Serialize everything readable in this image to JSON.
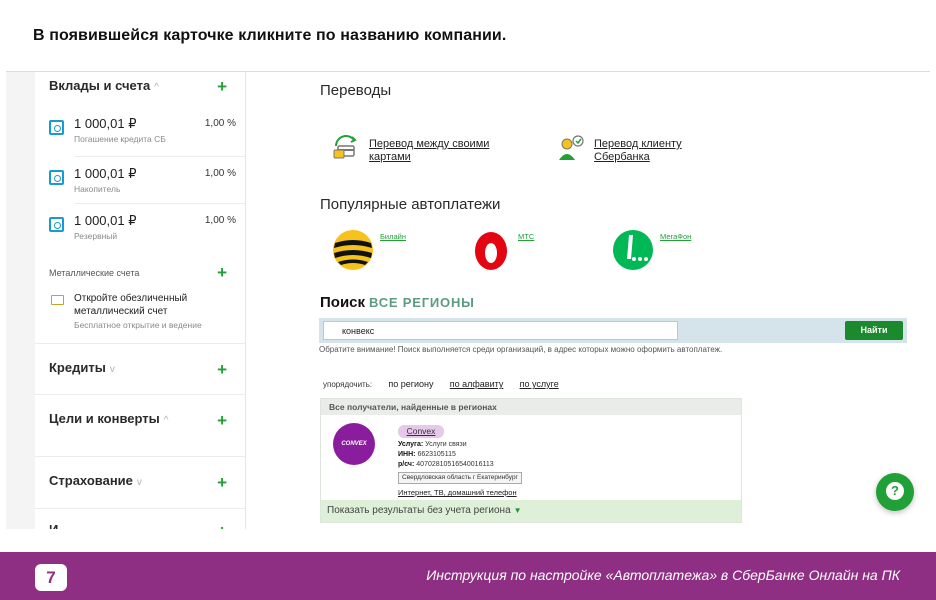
{
  "instruction": "В появившейся карточке кликните по названию компании.",
  "sidebar": {
    "deposits": {
      "title": "Вклады и счета",
      "chevron": "^",
      "plus": "+"
    },
    "accounts": [
      {
        "amount": "1 000,01 ₽",
        "name": "Погашение кредита СБ",
        "rate": "1,00 %"
      },
      {
        "amount": "1 000,01 ₽",
        "name": "Накопитель",
        "rate": "1,00 %"
      },
      {
        "amount": "1 000,01 ₽",
        "name": "Резервный",
        "rate": "1,00 %"
      }
    ],
    "metal": {
      "title": "Металлические счета",
      "plus": "+",
      "item_title": "Откройте обезличенный металлический счет",
      "item_sub": "Бесплатное открытие и ведение"
    },
    "credits": {
      "title": "Кредиты",
      "chevron": "v",
      "plus": "+"
    },
    "goals": {
      "title": "Цели и конверты",
      "chevron": "^",
      "plus": "+"
    },
    "insurance": {
      "title": "Страхование",
      "chevron": "v",
      "plus": "+"
    },
    "more": {
      "title": "И",
      "plus": "+"
    }
  },
  "main": {
    "transfers_title": "Переводы",
    "transfer_own": "Перевод между своими картами",
    "transfer_client": "Перевод клиенту Сбербанка",
    "autopay_title": "Популярные автоплатежи",
    "autopay": [
      {
        "name": "Билайн",
        "color": "#f6c21b"
      },
      {
        "name": "МТС",
        "color": "#e30611"
      },
      {
        "name": "МегаФон",
        "color": "#00b956"
      }
    ],
    "search": {
      "title": "Поиск",
      "region_link": "ВСЕ РЕГИОНЫ",
      "value": "конвекс",
      "button": "Найти",
      "note": "Обратите внимание! Поиск выполняется среди организаций, в адрес которых можно оформить автоплатеж."
    },
    "sort": {
      "label": "упорядочить:",
      "by_region": "по региону",
      "by_alpha": "по алфавиту",
      "by_service": "по услуге"
    },
    "results": {
      "header": "Все получатели, найденные в регионах",
      "company": {
        "logo_text": "CONVEX",
        "name": "Convex",
        "service_label": "Услуга:",
        "service": "Услуги связи",
        "inn_label": "ИНН:",
        "inn": "6623105115",
        "account_label": "р/сч:",
        "account": "40702810516540016113",
        "region": "Свердловская область г Екатеринбург",
        "services": "Интернет, ТВ, домашний телефон"
      },
      "show_all": "Показать результаты без учета региона"
    },
    "help": "?"
  },
  "footer": {
    "page_number": "7",
    "title": "Инструкция по настройке «Автоплатежа» в СберБанке Онлайн на ПК"
  },
  "colors": {
    "accent_green": "#21a038",
    "footer_purple": "#8f2f84",
    "company_purple": "#8a1c9e"
  }
}
